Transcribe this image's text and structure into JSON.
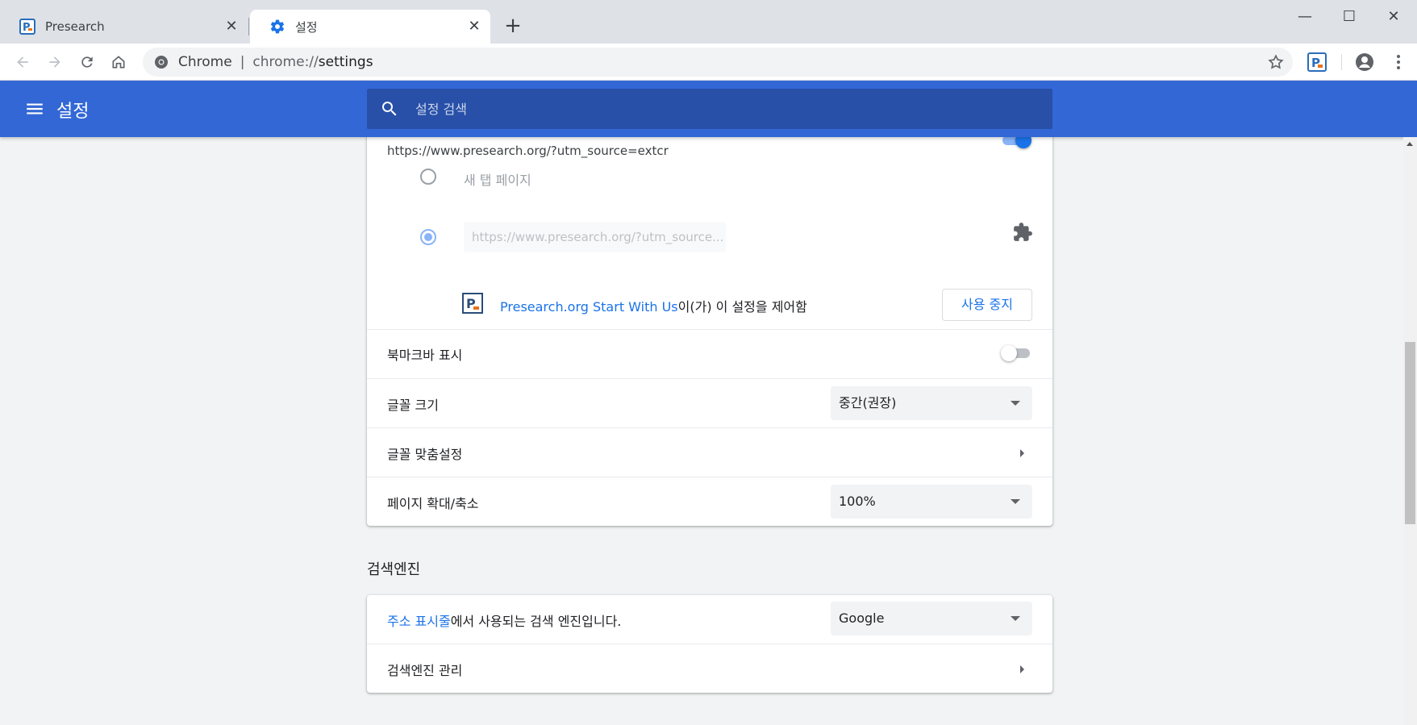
{
  "tabs": [
    {
      "title": "Presearch",
      "icon": "presearch-logo-icon",
      "active": false
    },
    {
      "title": "설정",
      "icon": "gear-icon",
      "active": true
    }
  ],
  "omnibox": {
    "chip": "Chrome",
    "divider": "|",
    "url_scheme": "chrome://",
    "url_path": "settings"
  },
  "header": {
    "title": "설정",
    "search_placeholder": "설정 검색"
  },
  "appearance": {
    "homepage_url": "https://www.presearch.org/?utm_source=extcr",
    "homepage_toggle_on": true,
    "option_newtab": "새 탭 페이지",
    "option_custom_url": "https://www.presearch.org/?utm_source...",
    "extension_name": "Presearch.org Start With Us",
    "extension_controls_text": "이(가) 이 설정을 제어함",
    "disable_button": "사용 중지",
    "bookmarks_bar_label": "북마크바 표시",
    "bookmarks_bar_on": false,
    "font_size_label": "글꼴 크기",
    "font_size_value": "중간(권장)",
    "customize_fonts_label": "글꼴 맞춤설정",
    "page_zoom_label": "페이지 확대/축소",
    "page_zoom_value": "100%"
  },
  "search_engine": {
    "section_title": "검색엔진",
    "address_bar_link": "주소 표시줄",
    "used_in_text": "에서 사용되는 검색 엔진입니다.",
    "engine_value": "Google",
    "manage_label": "검색엔진 관리"
  },
  "colors": {
    "header_blue": "#3367d6",
    "search_blue": "#2850a8",
    "link_blue": "#1a73e8",
    "toggle_on_blue": "#1a73e8",
    "toggle_track_on": "#8ab4f8"
  }
}
